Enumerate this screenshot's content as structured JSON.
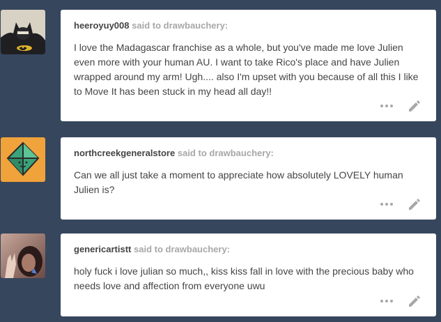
{
  "posts": [
    {
      "username": "heeroyuy008",
      "said_text": "said to",
      "recipient": "drawbauchery:",
      "message": "I love the Madagascar franchise as a whole, but you've made me love Julien even more with your human AU. I want to take Rico's place and have Julien wrapped around my arm! Ugh.... also I'm upset with you because of all this I like to Move It has been stuck in my head all day!!",
      "avatar": "batman-avatar"
    },
    {
      "username": "northcreekgeneralstore",
      "said_text": "said to",
      "recipient": "drawbauchery:",
      "message": "Can we all just take a moment to appreciate how absolutely LOVELY human Julien is?",
      "avatar": "geometric-gem-avatar"
    },
    {
      "username": "genericartistt",
      "said_text": "said to",
      "recipient": "drawbauchery:",
      "message": "holy fuck i love julian so much,, kiss kiss fall in love with the precious baby who needs love and affection from everyone uwu",
      "avatar": "selfie-avatar"
    }
  ],
  "colors": {
    "background": "#36465d",
    "card": "#ffffff",
    "text": "#444444",
    "muted": "#a7a7a7",
    "avatar_orange": "#f0a23b"
  }
}
